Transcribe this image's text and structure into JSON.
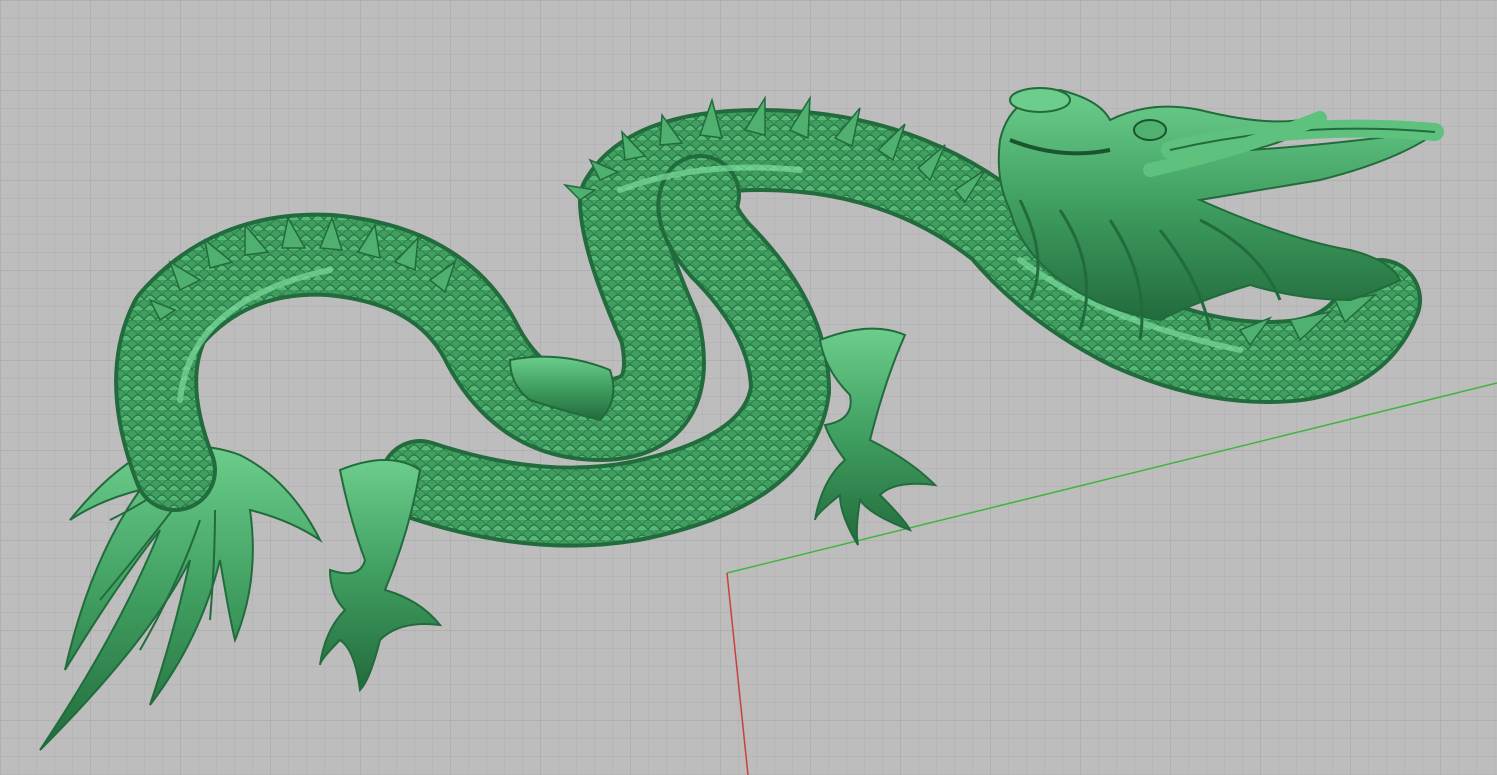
{
  "viewport": {
    "view": "perspective",
    "display_mode": "shaded",
    "grid": true
  },
  "scene": {
    "object": "dragon-mesh",
    "object_color": "#3f9e60"
  },
  "colors": {
    "background": "#bdbdbd",
    "grid_minor": "#b0b0b0",
    "grid_major": "#a3a3a3",
    "x_axis": "#c84040",
    "y_axis": "#3fb43f",
    "dragon_body": "#3f9e60",
    "dragon_light": "#6ccd8c",
    "dragon_dark": "#226b3c"
  }
}
